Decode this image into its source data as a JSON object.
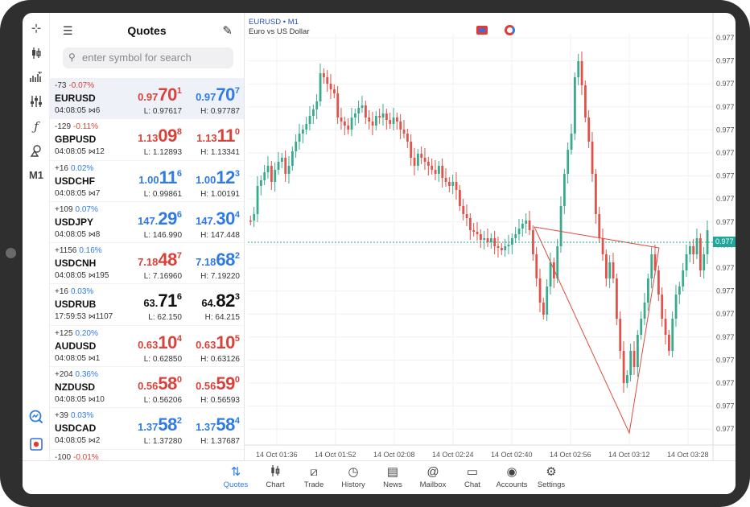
{
  "quotes_panel": {
    "title": "Quotes",
    "search_placeholder": "enter symbol for search",
    "rows": [
      {
        "chg": "-73",
        "pct": "-0.07%",
        "dir": "dn",
        "symbol": "EURUSD",
        "time": "04:08:05",
        "spread": "6",
        "bid_small": "0.97",
        "bid_big": "70",
        "bid_sup": "1",
        "ask_small": "0.97",
        "ask_big": "70",
        "ask_sup": "7",
        "bid_color": "dn",
        "ask_color": "up",
        "low": "L: 0.97617",
        "high": "H: 0.97787",
        "selected": true
      },
      {
        "chg": "-129",
        "pct": "-0.11%",
        "dir": "dn",
        "symbol": "GBPUSD",
        "time": "04:08:05",
        "spread": "12",
        "bid_small": "1.13",
        "bid_big": "09",
        "bid_sup": "8",
        "ask_small": "1.13",
        "ask_big": "11",
        "ask_sup": "0",
        "bid_color": "dn",
        "ask_color": "dn",
        "low": "L: 1.12893",
        "high": "H: 1.13341"
      },
      {
        "chg": "+16",
        "pct": "0.02%",
        "dir": "up",
        "symbol": "USDCHF",
        "time": "04:08:05",
        "spread": "7",
        "bid_small": "1.00",
        "bid_big": "11",
        "bid_sup": "6",
        "ask_small": "1.00",
        "ask_big": "12",
        "ask_sup": "3",
        "bid_color": "up",
        "ask_color": "up",
        "low": "L: 0.99861",
        "high": "H: 1.00191"
      },
      {
        "chg": "+109",
        "pct": "0.07%",
        "dir": "up",
        "symbol": "USDJPY",
        "time": "04:08:05",
        "spread": "8",
        "bid_small": "147.",
        "bid_big": "29",
        "bid_sup": "6",
        "ask_small": "147.",
        "ask_big": "30",
        "ask_sup": "4",
        "bid_color": "up",
        "ask_color": "up",
        "low": "L: 146.990",
        "high": "H: 147.448"
      },
      {
        "chg": "+1156",
        "pct": "0.16%",
        "dir": "up",
        "symbol": "USDCNH",
        "time": "04:08:05",
        "spread": "195",
        "bid_small": "7.18",
        "bid_big": "48",
        "bid_sup": "7",
        "ask_small": "7.18",
        "ask_big": "68",
        "ask_sup": "2",
        "bid_color": "dn",
        "ask_color": "up",
        "low": "L: 7.16960",
        "high": "H: 7.19220"
      },
      {
        "chg": "+16",
        "pct": "0.03%",
        "dir": "up",
        "symbol": "USDRUB",
        "time": "17:59:53",
        "spread": "1107",
        "bid_small": "63.",
        "bid_big": "71",
        "bid_sup": "6",
        "ask_small": "64.",
        "ask_big": "82",
        "ask_sup": "3",
        "bid_color": "nt",
        "ask_color": "nt",
        "low": "L: 62.150",
        "high": "H: 64.215"
      },
      {
        "chg": "+125",
        "pct": "0.20%",
        "dir": "up",
        "symbol": "AUDUSD",
        "time": "04:08:05",
        "spread": "1",
        "bid_small": "0.63",
        "bid_big": "10",
        "bid_sup": "4",
        "ask_small": "0.63",
        "ask_big": "10",
        "ask_sup": "5",
        "bid_color": "dn",
        "ask_color": "dn",
        "low": "L: 0.62850",
        "high": "H: 0.63126"
      },
      {
        "chg": "+204",
        "pct": "0.36%",
        "dir": "up",
        "symbol": "NZDUSD",
        "time": "04:08:05",
        "spread": "10",
        "bid_small": "0.56",
        "bid_big": "58",
        "bid_sup": "0",
        "ask_small": "0.56",
        "ask_big": "59",
        "ask_sup": "0",
        "bid_color": "dn",
        "ask_color": "dn",
        "low": "L: 0.56206",
        "high": "H: 0.56593"
      },
      {
        "chg": "+39",
        "pct": "0.03%",
        "dir": "up",
        "symbol": "USDCAD",
        "time": "04:08:05",
        "spread": "2",
        "bid_small": "1.37",
        "bid_big": "58",
        "bid_sup": "2",
        "ask_small": "1.37",
        "ask_big": "58",
        "ask_sup": "4",
        "bid_color": "up",
        "ask_color": "up",
        "low": "L: 1.37280",
        "high": "H: 1.37687"
      },
      {
        "chg": "-100",
        "pct": "-0.01%",
        "dir": "dn",
        "symbol": "",
        "time": "",
        "spread": "",
        "bid_small": "",
        "bid_big": "",
        "bid_sup": "",
        "ask_small": "",
        "ask_big": "",
        "ask_sup": "",
        "bid_color": "nt",
        "ask_color": "nt",
        "low": "",
        "high": ""
      }
    ]
  },
  "toolbar": {
    "items": [
      "crosshair-icon",
      "candles-icon",
      "bars-icon",
      "indicators-icon",
      "function-icon",
      "objects-icon",
      "timeframe"
    ],
    "timeframe_label": "M1"
  },
  "chart": {
    "symbol_line": "EURUSD • M1",
    "description": "Euro vs US Dollar",
    "current_price_tag": "0.977",
    "price_axis_label": "0.977",
    "time_labels": [
      "14 Oct 01:36",
      "14 Oct 01:52",
      "14 Oct 02:08",
      "14 Oct 02:24",
      "14 Oct 02:40",
      "14 Oct 02:56",
      "14 Oct 03:12",
      "14 Oct 03:28"
    ],
    "colors": {
      "bull": "#3aaa8c",
      "bear": "#e0524a",
      "line": "#e04a3f",
      "price_line": "#22a699"
    }
  },
  "nav": {
    "items": [
      {
        "label": "Quotes",
        "icon": "quotes-icon",
        "active": true
      },
      {
        "label": "Chart",
        "icon": "chart-icon"
      },
      {
        "label": "Trade",
        "icon": "trade-icon"
      },
      {
        "label": "History",
        "icon": "history-icon"
      },
      {
        "label": "News",
        "icon": "news-icon"
      },
      {
        "label": "Mailbox",
        "icon": "mailbox-icon"
      },
      {
        "label": "Chat",
        "icon": "chat-icon"
      },
      {
        "label": "Accounts",
        "icon": "accounts-icon"
      },
      {
        "label": "Settings",
        "icon": "settings-icon"
      }
    ]
  }
}
